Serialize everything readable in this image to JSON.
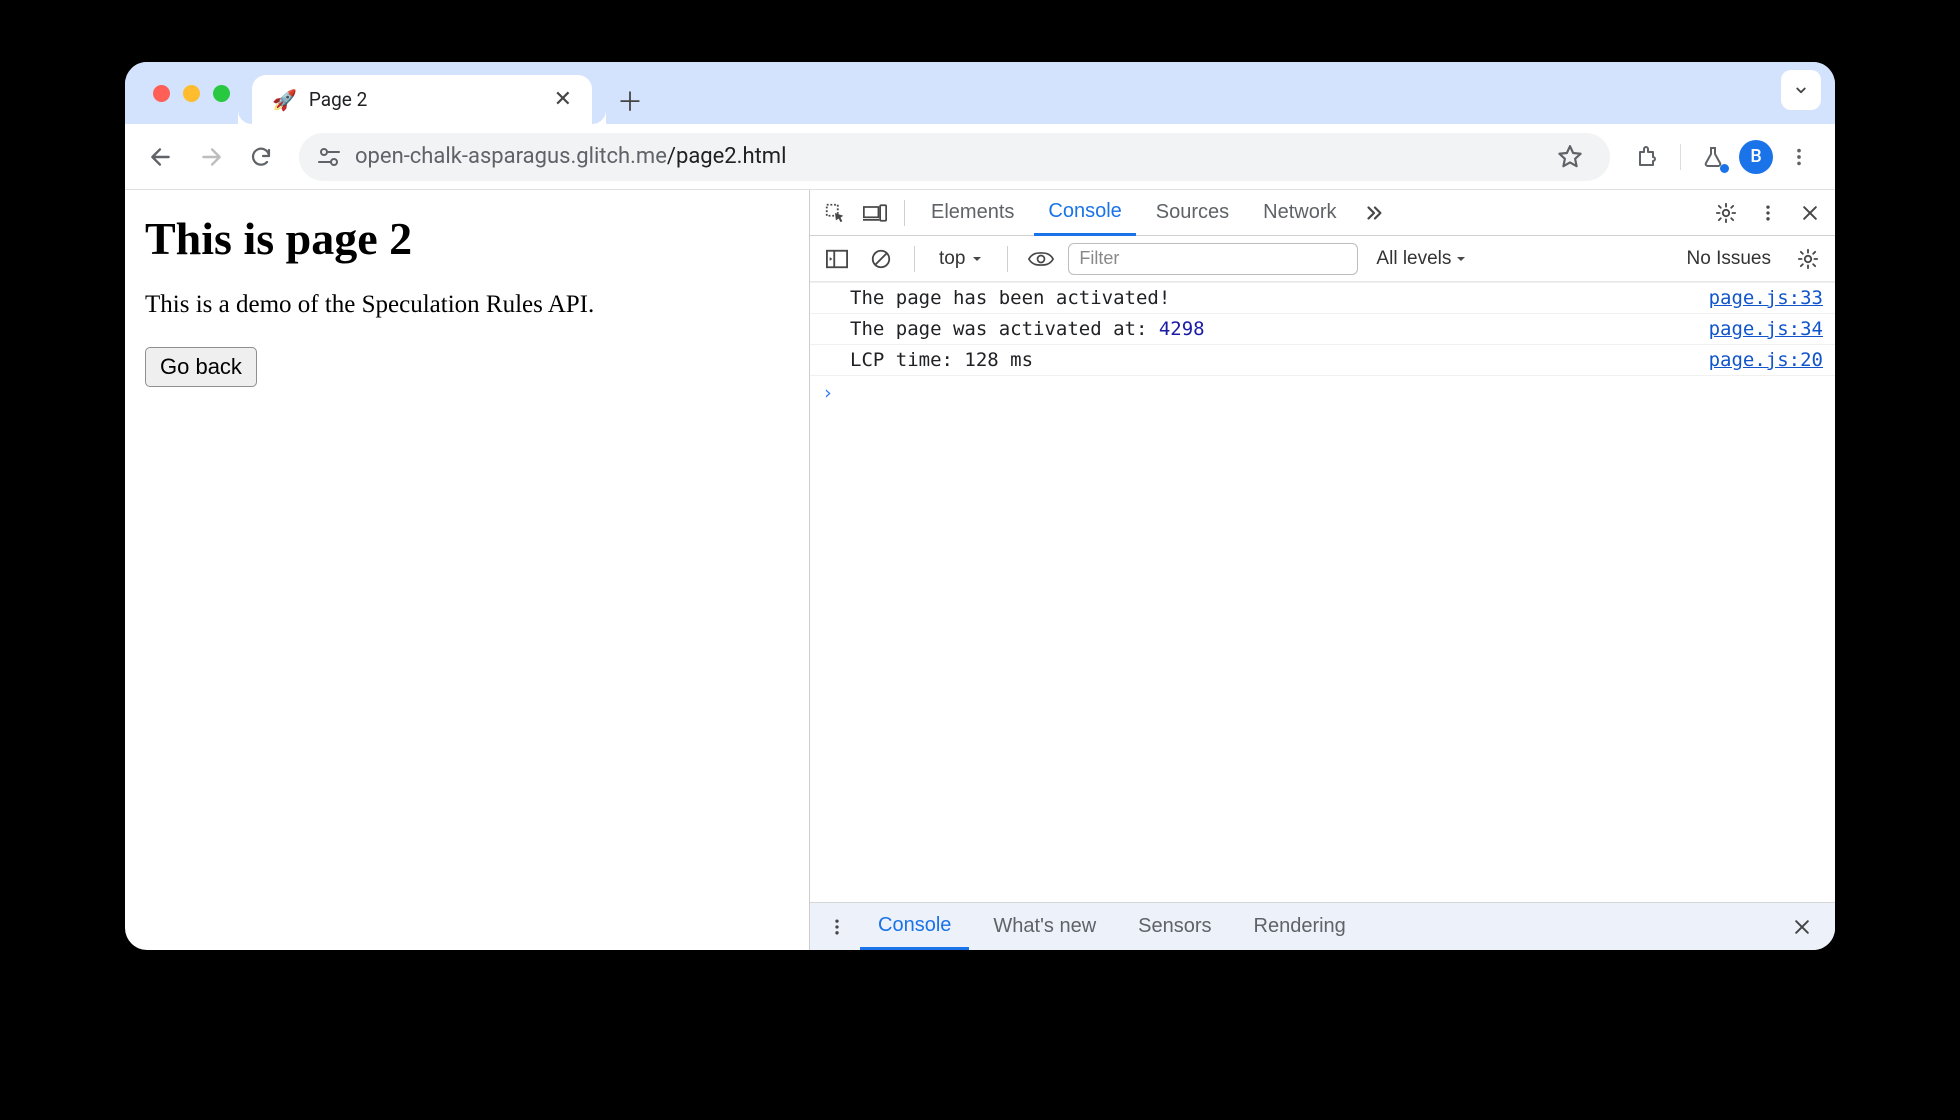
{
  "window": {
    "tab_title": "Page 2",
    "favicon": "🚀"
  },
  "toolbar": {
    "url_host": "open-chalk-asparagus.glitch.me",
    "url_path": "/page2.html",
    "avatar_initial": "B"
  },
  "page": {
    "heading": "This is page 2",
    "paragraph": "This is a demo of the Speculation Rules API.",
    "back_button": "Go back"
  },
  "devtools": {
    "tabs": [
      "Elements",
      "Console",
      "Sources",
      "Network"
    ],
    "active_tab": "Console",
    "console_toolbar": {
      "context": "top",
      "filter_placeholder": "Filter",
      "levels": "All levels",
      "issues": "No Issues"
    },
    "logs": [
      {
        "text": "The page has been activated!",
        "value": "",
        "source": "page.js:33"
      },
      {
        "text": "The page was activated at: ",
        "value": "4298",
        "source": "page.js:34"
      },
      {
        "text": "LCP time: 128 ms",
        "value": "",
        "source": "page.js:20"
      }
    ],
    "drawer_tabs": [
      "Console",
      "What's new",
      "Sensors",
      "Rendering"
    ],
    "drawer_active": "Console"
  }
}
